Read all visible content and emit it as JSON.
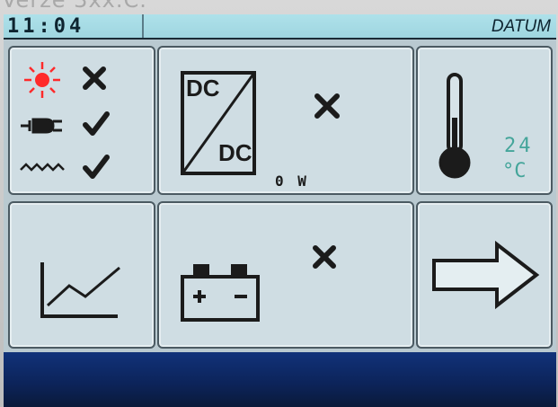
{
  "caption": "Verze 3xx.C.",
  "status_bar": {
    "time": "11:04",
    "date_label": "DATUM"
  },
  "tiles": {
    "sources": {
      "sun_status": "cross",
      "grid_status": "check",
      "wave_status": "check",
      "icons": [
        "sun-icon",
        "plug-icon",
        "wave-icon"
      ]
    },
    "converter": {
      "label_top": "DC",
      "label_bottom": "DC",
      "status": "cross",
      "power": "0 W"
    },
    "temperature": {
      "value": "24",
      "unit": "°C"
    },
    "chart": {
      "icon": "line-chart-icon"
    },
    "battery": {
      "status": "cross"
    },
    "next": {
      "icon": "arrow-right-icon"
    }
  },
  "colors": {
    "sun": "#ff2a2a",
    "status_bar": "#a6dbe4",
    "temperature_text": "#44a59a",
    "bottom_band": "#0c2358"
  }
}
